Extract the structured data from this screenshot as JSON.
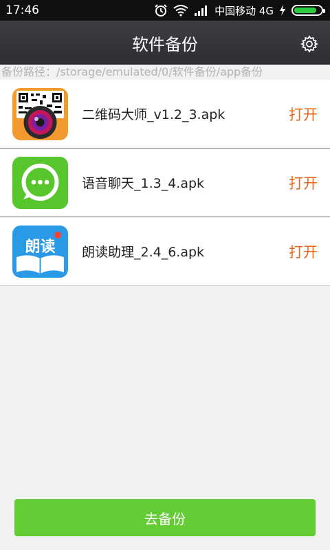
{
  "status_bar": {
    "time": "17:46",
    "carrier": "中国移动 4G",
    "battery_level": 0.85,
    "icons": [
      "alarm-icon",
      "wifi-icon",
      "signal-icon",
      "charging-icon",
      "battery-icon"
    ]
  },
  "header": {
    "title": "软件备份",
    "settings_icon": "gear-icon"
  },
  "backup_path": "备份路径：/storage/emulated/0/软件备份/app备份",
  "apps": [
    {
      "name": "二维码大师_v1.2_3.apk",
      "open_label": "打开",
      "icon": "qr-camera-app-icon"
    },
    {
      "name": "语音聊天_1.3_4.apk",
      "open_label": "打开",
      "icon": "chat-bubble-app-icon"
    },
    {
      "name": "朗读助理_2.4_6.apk",
      "open_label": "打开",
      "icon": "reading-book-app-icon",
      "icon_text": "朗读"
    }
  ],
  "footer": {
    "backup_button_label": "去备份"
  },
  "colors": {
    "accent_green": "#64cc35",
    "open_orange": "#e8681c",
    "header_dark": "#323438"
  }
}
